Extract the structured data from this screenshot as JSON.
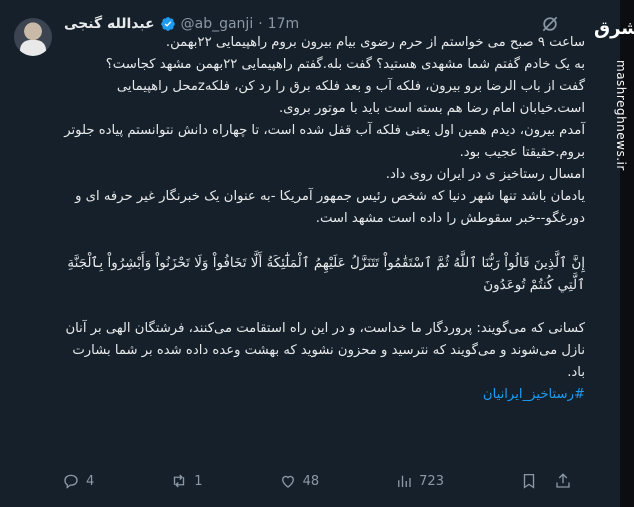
{
  "tweet": {
    "display_name": "عبدالله گنجی",
    "handle": "@ab_ganji",
    "separator": "·",
    "time": "17m",
    "body_lines": [
      "ساعت ۹ صبح می خواستم از حرم رضوی بیام بیرون بروم راهپیمایی ۲۲بهمن.",
      "به یک خادم گفتم شما مشهدی هستید؟ گفت بله.گفتم راهپیمایی ۲۲بهمن مشهد کجاست؟",
      "گفت از باب الرضا برو بیرون، فلکه آب و بعد فلکه برق را رد کن، فلکهzمحل راهپیمایی است.خیابان امام رضا هم بسته است باید با موتور بروی.",
      "آمدم بیرون، دیدم همین اول یعنی فلکه آب قفل شده است، تا چهاراه دانش نتوانستم پیاده جلوتر بروم.حقیقتا عجیب بود.",
      "امسال رستاخیز ی در ایران روی داد.",
      "یادمان باشد تنها شهر دنیا که شخص رئیس جمهور آمریکا -به عنوان یک خبرنگار غیر حرفه ای و دورغگو--خبر سقوطش را داده است مشهد است."
    ],
    "quran": "إِنَّ ٱلَّذِينَ قَالُواْ رَبُّنَا ٱللَّهُ ثُمَّ ٱسْتَقَٰمُواْ تَتَنَزَّلُ عَلَيْهِمُ ٱلْمَلَٰٓئِكَةُ أَلَّا تَخَافُواْ وَلَا تَحْزَنُواْ وَأَبْشِرُواْ بِٱلْجَنَّةِ ٱلَّتِي كُنتُمْ تُوعَدُونَ",
    "translation": "کسانی که می‌گویند: پروردگار ما خداست، و در این راه استقامت می‌کنند، فرشتگان الهی بر آنان نازل می‌شوند و می‌گویند که نترسید و محزون نشوید که بهشت وعده داده شده بر شما بشارت باد.",
    "translation_prefix_glyph": "",
    "hashtag": "#رستاخیز_ایرانیان"
  },
  "actions": {
    "replies": "4",
    "retweets": "1",
    "likes": "48",
    "views": "723"
  },
  "watermark": {
    "logo": "مشرق",
    "site": "mashreghnews.ir"
  },
  "colors": {
    "background": "#15202b",
    "text": "#e7e9ea",
    "muted": "#8b98a5",
    "link": "#1d9bf0",
    "verified": "#1d9bf0"
  }
}
